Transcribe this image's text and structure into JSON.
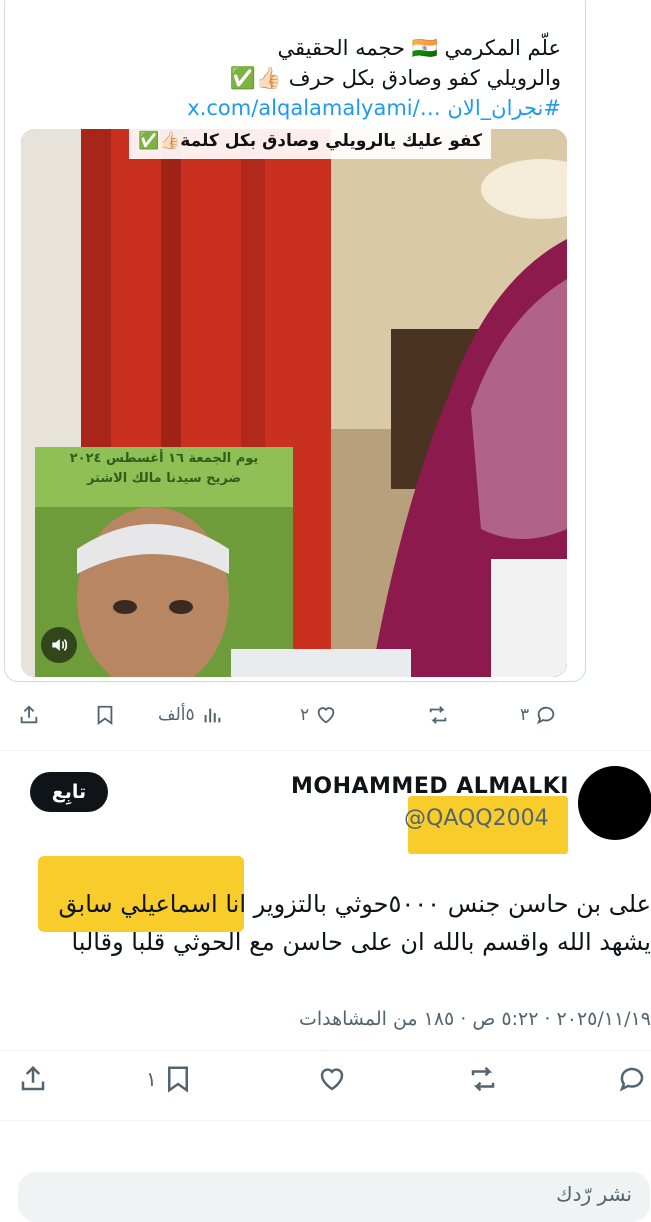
{
  "quoted_post": {
    "line1": "علّم المكرمي 🇮🇳 حجمه الحقيقي",
    "line2": "والرويلي كفو وصادق بكل حرف 👍🏻✅",
    "hashtag": "#نجران_الان",
    "link": "x.com/alqalamalyami/…",
    "media": {
      "caption": "كفو عليك يالرويلي وصادق بكل كلمة👍🏻✅",
      "overlay_line1": "يوم الجمعة ١٦ أغسطس ٢٠٢٤",
      "overlay_line2": "ضريح سيدنا مالك الاشتر",
      "sound_icon": "speaker-icon"
    },
    "actions": {
      "replies": "٣",
      "reposts": "",
      "likes": "٢",
      "views": "٥ألف"
    }
  },
  "post": {
    "author_name": "MOHAMMED ALMALKI",
    "author_handle": "@QAQQ2004",
    "follow_label": "تابِع",
    "text_line1": "على بن حاسن جنس ٥٠٠٠حوثي بالتزوير انا اسماعيلي سابق",
    "text_line2": "يشهد الله واقسم بالله ان على حاسن مع الحوثي قلبا وقالبا",
    "meta": "٢٠٢٥/١١/١٩ · ٥:٢٢ ص · ١٨٥ من المشاهدات",
    "actions": {
      "replies": "",
      "reposts": "",
      "likes": "",
      "bookmarks": "١"
    }
  },
  "reply_placeholder": "نشر رّدك",
  "colors": {
    "highlight": "#f8cd2b",
    "link": "#1d9bf0",
    "muted": "#536471",
    "follow_bg": "#0f1419"
  }
}
